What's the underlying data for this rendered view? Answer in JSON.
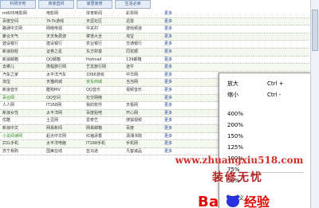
{
  "tabs": [
    "科研天地",
    "商家直供",
    "家居装修",
    "生活必读"
  ],
  "rows": [
    {
      "cells": [
        "mi605电影网",
        "电影网",
        "体育新闻",
        "彩票网"
      ],
      "more": "更多",
      "alt": false
    },
    {
      "cells": [
        "百度空间",
        "7k7k游戏",
        "天涯社区",
        "迅雷"
      ],
      "more": "更多",
      "alt": true
    },
    {
      "cells": [
        "路通中文网",
        "网络电视",
        "中关村",
        "游戏频道"
      ],
      "more": "更多",
      "alt": false
    },
    {
      "cells": [
        "聚合天气",
        "天天免费游",
        "菜谱大全",
        "淘宝"
      ],
      "more": "更多",
      "alt": true
    },
    {
      "cells": [
        "建设银行",
        "建设银行",
        "农业银行",
        "交通银行"
      ],
      "more": "更多",
      "alt": false
    },
    {
      "cells": [
        "新浪财经",
        "证券之星",
        "东方财富",
        "同花顺"
      ],
      "more": "更多",
      "alt": true
    },
    {
      "cells": [
        "新浪邮箱",
        "QQ邮箱",
        "Hotmail",
        "139邮箱"
      ],
      "more": "更多",
      "alt": false
    },
    {
      "cells": [
        "去哪儿",
        "携程旅行网",
        "艺龙旅行网",
        "途牛"
      ],
      "more": "更多",
      "alt": true
    },
    {
      "cells": [
        "汽车之家",
        "太平洋汽车",
        "3366游戏",
        "中华网"
      ],
      "more": "更多",
      "alt": false
    },
    {
      "cells": [
        "淘宝",
        "天猫商城",
        "京东商城",
        "当当网"
      ],
      "more": "更多",
      "alt": true
    },
    {
      "cells": [
        "新浪音乐",
        "酷狗MV",
        "QQ音乐",
        "视频音乐"
      ],
      "more": "更多",
      "alt": false
    },
    {
      "cells": [
        "百合网",
        "QQ空间",
        "社交网络"
      ],
      "more": "更多",
      "alt": true
    },
    {
      "cells": [
        "人人网",
        "IT168网",
        "我的软件",
        "天极网"
      ],
      "more": "更多",
      "alt": false
    },
    {
      "cells": [
        "新浪女性",
        "太平洋网",
        "百度贴吧",
        "开心网"
      ],
      "more": "更多",
      "alt": true
    },
    {
      "cells": [
        "优酷",
        "土豆网",
        "爱奇艺",
        "搜狐视频"
      ],
      "more": "更多",
      "alt": false
    },
    {
      "cells": [
        "新浪中文",
        "网易新闻",
        "网易邮箱",
        "百度"
      ],
      "more": "更多",
      "alt": true
    },
    {
      "cells": [
        "小说阅读网",
        "起点中文网",
        "红袖添香",
        "潇湘书院"
      ],
      "more": "更多",
      "alt": false
    },
    {
      "cells": [
        "ZOL手机",
        "太平洋电脑",
        "IT168手机",
        "手机网"
      ],
      "more": "更多",
      "alt": true
    },
    {
      "cells": [
        "苏宁易购",
        "国美在线",
        "亚马逊",
        "凡客诚品"
      ],
      "more": "更多",
      "alt": false
    }
  ],
  "context_menu": {
    "items": [
      {
        "label": "放大",
        "shortcut": "Ctrl +"
      },
      {
        "label": "缩小",
        "shortcut": "Ctrl -"
      },
      {
        "label": "400%",
        "shortcut": ""
      },
      {
        "label": "200%",
        "shortcut": ""
      },
      {
        "label": "150%",
        "shortcut": ""
      },
      {
        "label": "125%",
        "shortcut": ""
      },
      {
        "label": "100%",
        "shortcut": ""
      },
      {
        "label": "75%",
        "shortcut": ""
      },
      {
        "label": "50%",
        "shortcut": ""
      },
      {
        "label": "自定义...",
        "shortcut": ""
      }
    ]
  },
  "watermark": {
    "url": "www.zhuangxiu518.com",
    "text": "装修无忧"
  },
  "colors": {
    "link": "#1b3f8f",
    "highlight": "#2c8a1e",
    "watermark": "#d0312d",
    "baidu_blue": "#2932e1",
    "baidu_red": "#e10602"
  }
}
